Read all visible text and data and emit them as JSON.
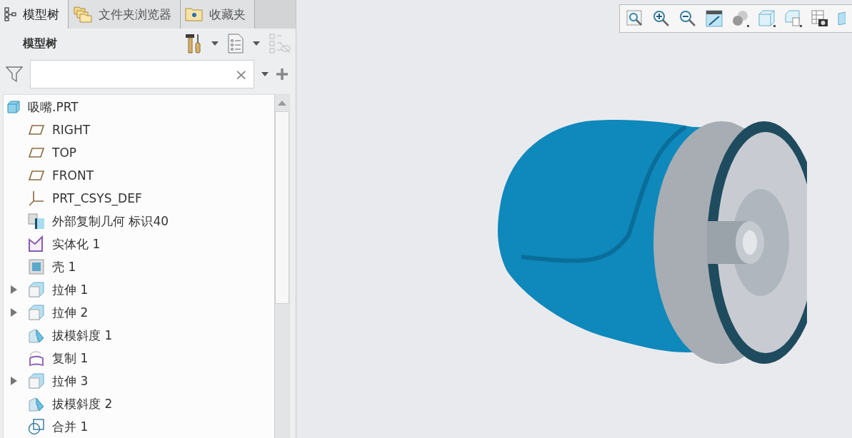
{
  "tabs": [
    {
      "label": "模型树",
      "kind": "tree",
      "selected": true
    },
    {
      "label": "文件夹浏览器",
      "kind": "folders",
      "selected": false
    },
    {
      "label": "收藏夹",
      "kind": "favorites",
      "selected": false
    }
  ],
  "panel": {
    "title": "模型树"
  },
  "filter": {
    "clear": "×"
  },
  "tree": {
    "label": "吸嘴.PRT",
    "kind": "part",
    "children": [
      {
        "label": "RIGHT",
        "kind": "plane"
      },
      {
        "label": "TOP",
        "kind": "plane"
      },
      {
        "label": "FRONT",
        "kind": "plane"
      },
      {
        "label": "PRT_CSYS_DEF",
        "kind": "csys"
      },
      {
        "label": "外部复制几何 标识40",
        "kind": "copygeom"
      },
      {
        "label": "实体化 1",
        "kind": "solidify"
      },
      {
        "label": "壳 1",
        "kind": "shell"
      },
      {
        "label": "拉伸 1",
        "kind": "extrude",
        "expanded": false
      },
      {
        "label": "拉伸 2",
        "kind": "extrude",
        "expanded": false
      },
      {
        "label": "拔模斜度 1",
        "kind": "draft"
      },
      {
        "label": "复制 1",
        "kind": "copy"
      },
      {
        "label": "拉伸 3",
        "kind": "extrude",
        "expanded": false
      },
      {
        "label": "拔模斜度 2",
        "kind": "draft"
      },
      {
        "label": "合并 1",
        "kind": "merge"
      }
    ]
  }
}
